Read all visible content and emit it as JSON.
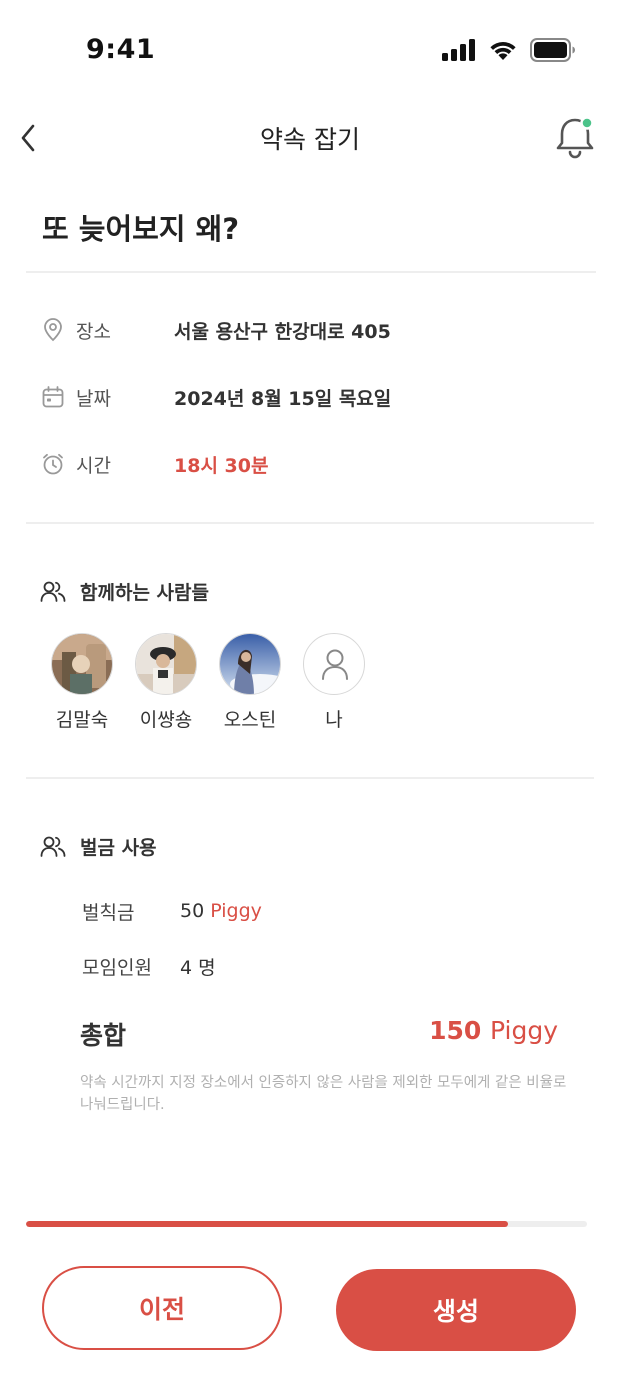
{
  "status": {
    "time": "9:41"
  },
  "header": {
    "title": "약속 잡기"
  },
  "page": {
    "title": "또 늦어보지 왜?"
  },
  "info": {
    "place": {
      "label": "장소",
      "value": "서울 용산구 한강대로 405"
    },
    "date": {
      "label": "날짜",
      "value": "2024년 8월 15일 목요일"
    },
    "time": {
      "label": "시간",
      "value": "18시 30분"
    }
  },
  "people": {
    "label": "함께하는 사람들",
    "members": [
      {
        "name": "김말숙"
      },
      {
        "name": "이썅숑"
      },
      {
        "name": "오스틴"
      },
      {
        "name": "나"
      }
    ]
  },
  "fine": {
    "label": "벌금 사용",
    "penalty": {
      "label": "벌칙금",
      "amount": "50",
      "unit": "Piggy"
    },
    "members": {
      "label": "모임인원",
      "value": "4 명"
    },
    "total": {
      "label": "총합",
      "amount": "150",
      "unit": "Piggy"
    },
    "notice": "약속 시간까지 지정 장소에서 인증하지 않은 사람을 제외한 모두에게 같은 비율로 나눠드립니다."
  },
  "progress": {
    "value": 0.86
  },
  "buttons": {
    "prev": "이전",
    "create": "생성"
  },
  "colors": {
    "accent": "#d94f45",
    "notification_dot": "#4cc38a"
  }
}
